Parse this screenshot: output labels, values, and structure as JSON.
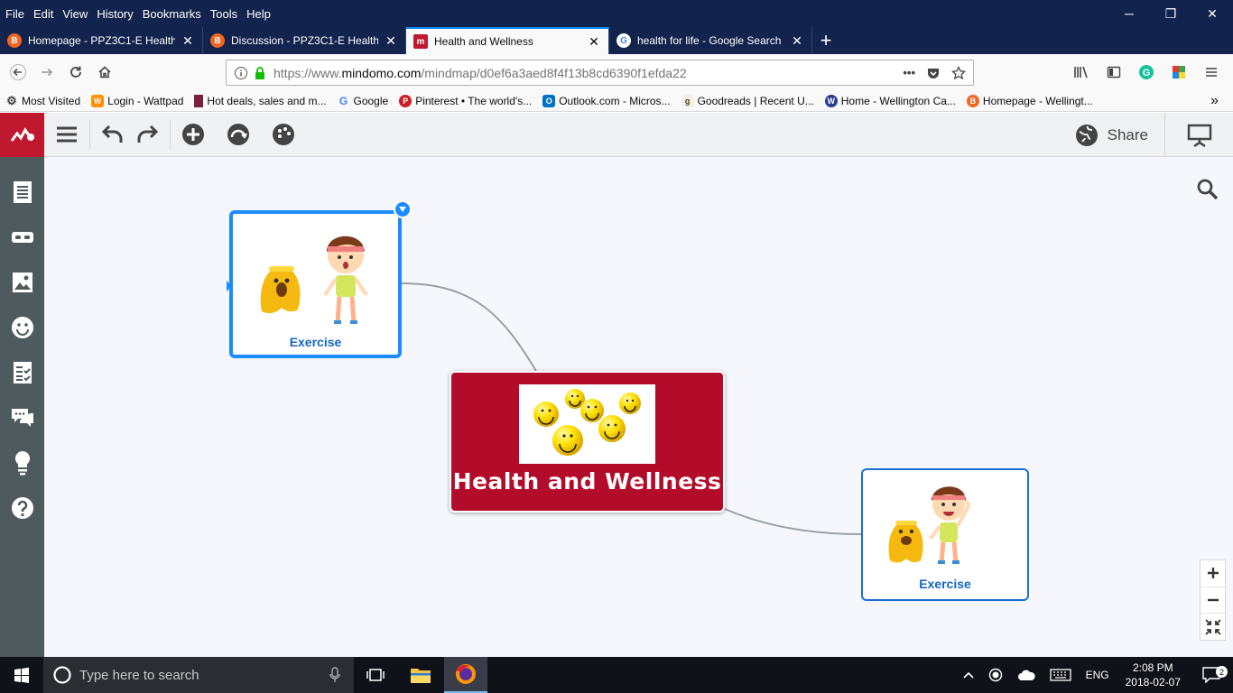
{
  "menubar": {
    "items": [
      "File",
      "Edit",
      "View",
      "History",
      "Bookmarks",
      "Tools",
      "Help"
    ],
    "minimize": "─",
    "restore": "❐",
    "close": "✕"
  },
  "tabs": [
    {
      "title": "Homepage - PPZ3C1-E Health I",
      "favicon_color": "#f26522"
    },
    {
      "title": "Discussion - PPZ3C1-E Health I",
      "favicon_color": "#f26522"
    },
    {
      "title": "Health and Wellness",
      "favicon_color": "#c0182e",
      "active": true
    },
    {
      "title": "health for life - Google Search",
      "favicon_color": "#4285f4"
    }
  ],
  "navbar": {
    "url_prefix": "https://www.",
    "url_domain": "mindomo.com",
    "url_path": "/mindmap/d0ef6a3aed8f4f13b8cd6390f1efda22",
    "page_actions": "•••"
  },
  "bookmarks": [
    {
      "label": "Most Visited",
      "icon": "gear-icon",
      "color": "#444444"
    },
    {
      "label": "Login - Wattpad",
      "icon": "wattpad-icon",
      "color": "#ff8f00"
    },
    {
      "label": "Hot deals, sales and m...",
      "icon": "deals-icon",
      "color": "#7a1f3d"
    },
    {
      "label": "Google",
      "icon": "google-icon",
      "color": "#4285f4"
    },
    {
      "label": "Pinterest • The world's...",
      "icon": "pinterest-icon",
      "color": "#cb2027"
    },
    {
      "label": "Outlook.com - Micros...",
      "icon": "outlook-icon",
      "color": "#0072c6"
    },
    {
      "label": "Goodreads | Recent U...",
      "icon": "goodreads-icon",
      "color": "#b9a98c"
    },
    {
      "label": "Home - Wellington Ca...",
      "icon": "wellington-icon",
      "color": "#2a3e8f"
    },
    {
      "label": "Homepage - Wellingt...",
      "icon": "brightspace-icon",
      "color": "#f26522"
    }
  ],
  "mindomo": {
    "share_label": "Share",
    "central_title": "Health and Wellness",
    "node1_label": "Exercise",
    "node2_label": "Exercise"
  },
  "taskbar": {
    "search_placeholder": "Type here to search",
    "lang": "ENG",
    "time": "2:08 PM",
    "date": "2018-02-07",
    "notifications": "2"
  }
}
